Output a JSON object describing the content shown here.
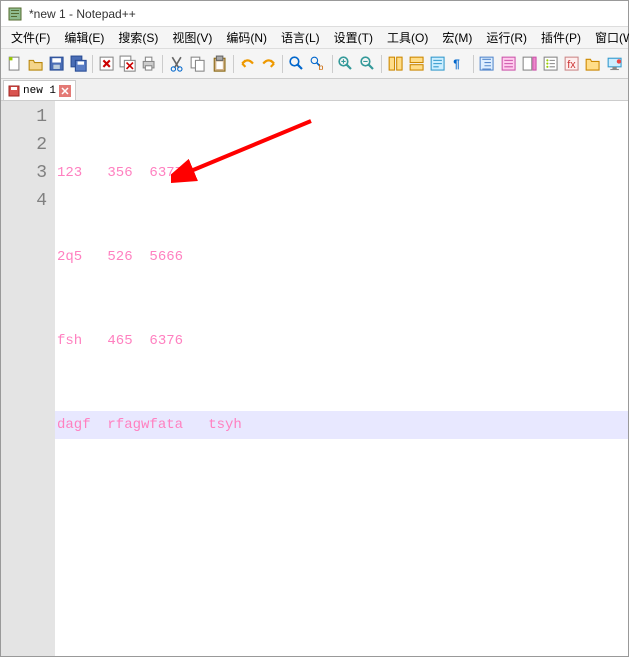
{
  "window": {
    "title": "*new 1 - Notepad++"
  },
  "menubar": {
    "items": [
      {
        "label": "文件(F)"
      },
      {
        "label": "编辑(E)"
      },
      {
        "label": "搜索(S)"
      },
      {
        "label": "视图(V)"
      },
      {
        "label": "编码(N)"
      },
      {
        "label": "语言(L)"
      },
      {
        "label": "设置(T)"
      },
      {
        "label": "工具(O)"
      },
      {
        "label": "宏(M)"
      },
      {
        "label": "运行(R)"
      },
      {
        "label": "插件(P)"
      },
      {
        "label": "窗口(W)"
      }
    ]
  },
  "tabs": [
    {
      "label": "new 1",
      "unsaved": true
    }
  ],
  "editor": {
    "lines": [
      {
        "num": "1",
        "text": "123   356  6377"
      },
      {
        "num": "2",
        "text": "2q5   526  5666"
      },
      {
        "num": "3",
        "text": "fsh   465  6376"
      },
      {
        "num": "4",
        "text": "dagf  rfagwfata   tsyh",
        "active": true
      }
    ]
  }
}
